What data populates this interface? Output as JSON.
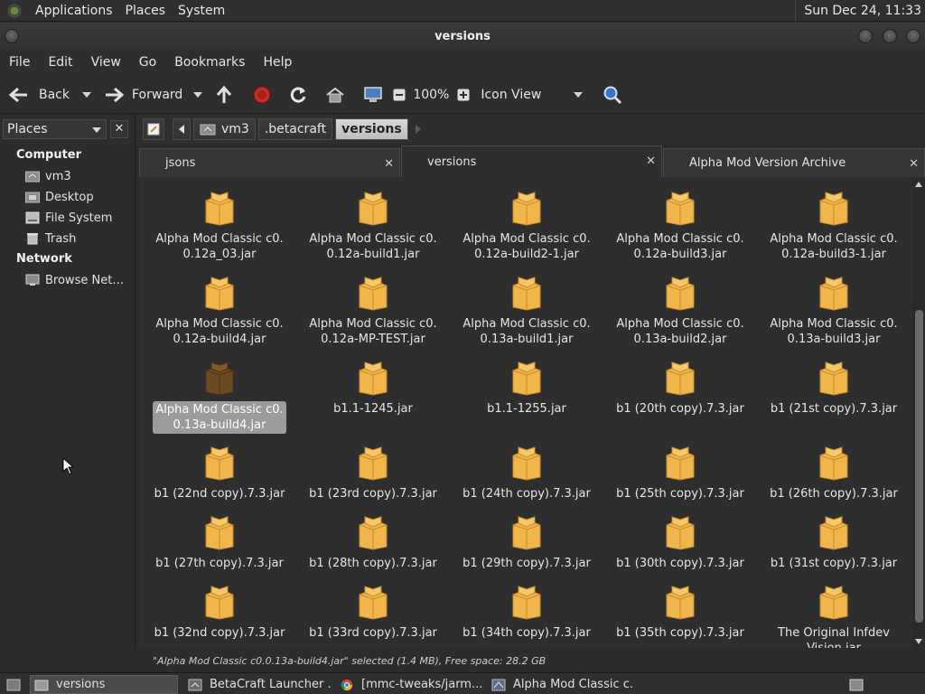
{
  "panel": {
    "menus": [
      "Applications",
      "Places",
      "System"
    ],
    "clock": "Sun Dec 24, 11:33"
  },
  "window": {
    "title": "versions"
  },
  "menubar": [
    "File",
    "Edit",
    "View",
    "Go",
    "Bookmarks",
    "Help"
  ],
  "toolbar": {
    "back": "Back",
    "forward": "Forward",
    "zoom": "100%",
    "view_mode": "Icon View"
  },
  "places": {
    "header": "Places",
    "close": "✕",
    "computer_label": "Computer",
    "computer_items": [
      "vm3",
      "Desktop",
      "File System",
      "Trash"
    ],
    "network_label": "Network",
    "network_items": [
      "Browse Net…"
    ]
  },
  "pathbar": {
    "segments": [
      "vm3",
      ".betacraft",
      "versions"
    ]
  },
  "tabs": [
    {
      "label": "jsons"
    },
    {
      "label": "versions"
    },
    {
      "label": "Alpha Mod Version Archive"
    }
  ],
  "files": [
    {
      "name": [
        "Alpha Mod Classic c0.",
        "0.12a_03.jar"
      ]
    },
    {
      "name": [
        "Alpha Mod Classic c0.",
        "0.12a-build1.jar"
      ]
    },
    {
      "name": [
        "Alpha Mod Classic c0.",
        "0.12a-build2-1.jar"
      ]
    },
    {
      "name": [
        "Alpha Mod Classic c0.",
        "0.12a-build3.jar"
      ]
    },
    {
      "name": [
        "Alpha Mod Classic c0.",
        "0.12a-build3-1.jar"
      ]
    },
    {
      "name": [
        "Alpha Mod Classic c0.",
        "0.12a-build4.jar"
      ]
    },
    {
      "name": [
        "Alpha Mod Classic c0.",
        "0.12a-MP-TEST.jar"
      ]
    },
    {
      "name": [
        "Alpha Mod Classic c0.",
        "0.13a-build1.jar"
      ]
    },
    {
      "name": [
        "Alpha Mod Classic c0.",
        "0.13a-build2.jar"
      ]
    },
    {
      "name": [
        "Alpha Mod Classic c0.",
        "0.13a-build3.jar"
      ]
    },
    {
      "name": [
        "Alpha Mod Classic c0.",
        "0.13a-build4.jar"
      ],
      "selected": true
    },
    {
      "name": [
        "b1.1-1245.jar"
      ]
    },
    {
      "name": [
        "b1.1-1255.jar"
      ]
    },
    {
      "name": [
        "b1 (20th copy).7.3.jar"
      ]
    },
    {
      "name": [
        "b1 (21st copy).7.3.jar"
      ]
    },
    {
      "name": [
        "b1 (22nd copy).7.3.jar"
      ]
    },
    {
      "name": [
        "b1 (23rd copy).7.3.jar"
      ]
    },
    {
      "name": [
        "b1 (24th copy).7.3.jar"
      ]
    },
    {
      "name": [
        "b1 (25th copy).7.3.jar"
      ]
    },
    {
      "name": [
        "b1 (26th copy).7.3.jar"
      ]
    },
    {
      "name": [
        "b1 (27th copy).7.3.jar"
      ]
    },
    {
      "name": [
        "b1 (28th copy).7.3.jar"
      ]
    },
    {
      "name": [
        "b1 (29th copy).7.3.jar"
      ]
    },
    {
      "name": [
        "b1 (30th copy).7.3.jar"
      ]
    },
    {
      "name": [
        "b1 (31st copy).7.3.jar"
      ]
    },
    {
      "name": [
        "b1 (32nd copy).7.3.jar"
      ]
    },
    {
      "name": [
        "b1 (33rd copy).7.3.jar"
      ]
    },
    {
      "name": [
        "b1 (34th copy).7.3.jar"
      ]
    },
    {
      "name": [
        "b1 (35th copy).7.3.jar"
      ]
    },
    {
      "name": [
        "The Original Infdev",
        "Vision.jar"
      ]
    }
  ],
  "status": "\"Alpha Mod Classic c0.0.13a-build4.jar\" selected (1.4 MB), Free space: 28.2 GB",
  "taskbar": {
    "tasks": [
      "versions",
      "BetaCraft Launcher ...",
      "[mmc-tweaks/jarm...",
      "Alpha Mod Classic c..."
    ]
  },
  "colors": {
    "background": "#2e2e2e",
    "package_icon": "#f0b64c",
    "package_icon_dark": "#6e4a22",
    "selection": "#9b9b9b"
  }
}
